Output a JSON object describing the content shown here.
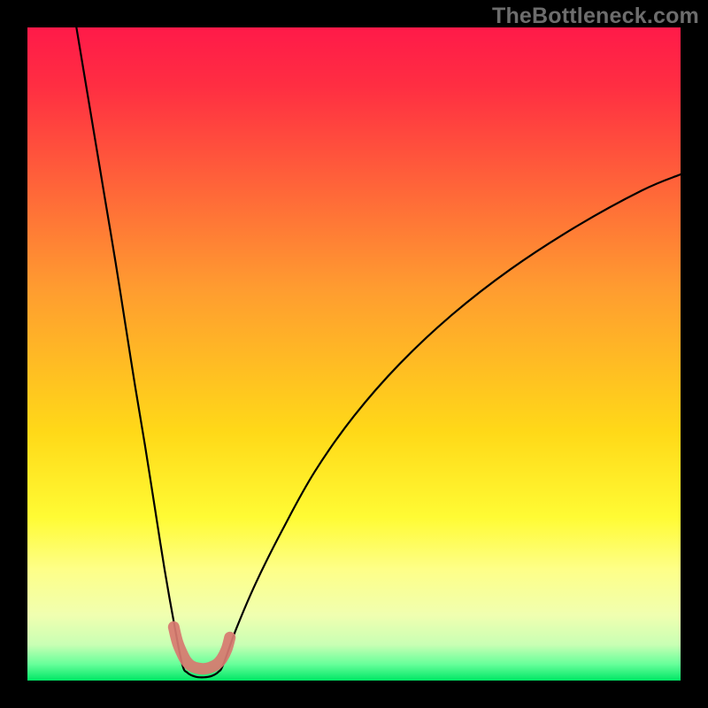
{
  "watermark": "TheBottleneck.com",
  "chart_data": {
    "type": "line",
    "title": "",
    "xlabel": "",
    "ylabel": "",
    "xlim": [
      0,
      100
    ],
    "ylim": [
      0,
      100
    ],
    "gradient_stops": [
      {
        "offset": 0.0,
        "color": "#ff1a49"
      },
      {
        "offset": 0.09,
        "color": "#ff2e42"
      },
      {
        "offset": 0.4,
        "color": "#ff9c30"
      },
      {
        "offset": 0.62,
        "color": "#ffd918"
      },
      {
        "offset": 0.75,
        "color": "#fffb34"
      },
      {
        "offset": 0.83,
        "color": "#feff88"
      },
      {
        "offset": 0.9,
        "color": "#f0ffb0"
      },
      {
        "offset": 0.945,
        "color": "#c9ffb4"
      },
      {
        "offset": 0.975,
        "color": "#67ff9a"
      },
      {
        "offset": 1.0,
        "color": "#00e765"
      }
    ],
    "series": [
      {
        "name": "left-branch",
        "x": [
          7.5,
          9,
          10.5,
          12,
          13.5,
          15,
          16.5,
          18,
          19.5,
          21,
          22.5,
          23.7
        ],
        "y": [
          100,
          91,
          82,
          73,
          64,
          54.5,
          45,
          36,
          26.5,
          17,
          8.5,
          2.5
        ]
      },
      {
        "name": "right-branch",
        "x": [
          30,
          32,
          35,
          39,
          44,
          50,
          57,
          65,
          74,
          84,
          94,
          100
        ],
        "y": [
          2.5,
          8,
          15,
          23,
          32,
          40.5,
          48.5,
          56,
          63,
          69.5,
          75,
          77.5
        ]
      },
      {
        "name": "valley",
        "x": [
          23.7,
          24.5,
          25.7,
          27,
          28.2,
          29.2,
          30
        ],
        "y": [
          2.5,
          1.2,
          0.6,
          0.5,
          0.7,
          1.3,
          2.5
        ]
      }
    ],
    "highlight_band": {
      "name": "valley-marker",
      "color": "#d77a70",
      "points_x": [
        22.4,
        23.0,
        23.8,
        24.3,
        25.0,
        26.0,
        27.0,
        28.0,
        29.0,
        29.8,
        30.5,
        31.0
      ],
      "points_y": [
        8.2,
        5.8,
        3.9,
        3.0,
        2.3,
        1.9,
        1.8,
        2.0,
        2.5,
        3.4,
        4.8,
        6.6
      ]
    }
  }
}
